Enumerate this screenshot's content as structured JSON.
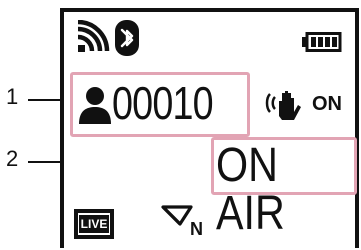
{
  "callouts": [
    {
      "number": "1"
    },
    {
      "number": "2"
    }
  ],
  "status_bar": {
    "wifi_icon": "wifi-signal-icon",
    "bluetooth_icon": "bluetooth-icon",
    "battery_icon": "battery-full-icon"
  },
  "live_counter": {
    "viewer_icon": "person-icon",
    "count": "00010"
  },
  "steadyshot": {
    "icon": "steadyshot-hand-icon",
    "state": "ON"
  },
  "broadcast_status": "ON AIR",
  "bottom_bar": {
    "live_label": "LIVE",
    "level_icon": "level-gauge-icon",
    "level_suffix": "N"
  },
  "colors": {
    "highlight": "#e2a4b4",
    "foreground": "#111111"
  }
}
